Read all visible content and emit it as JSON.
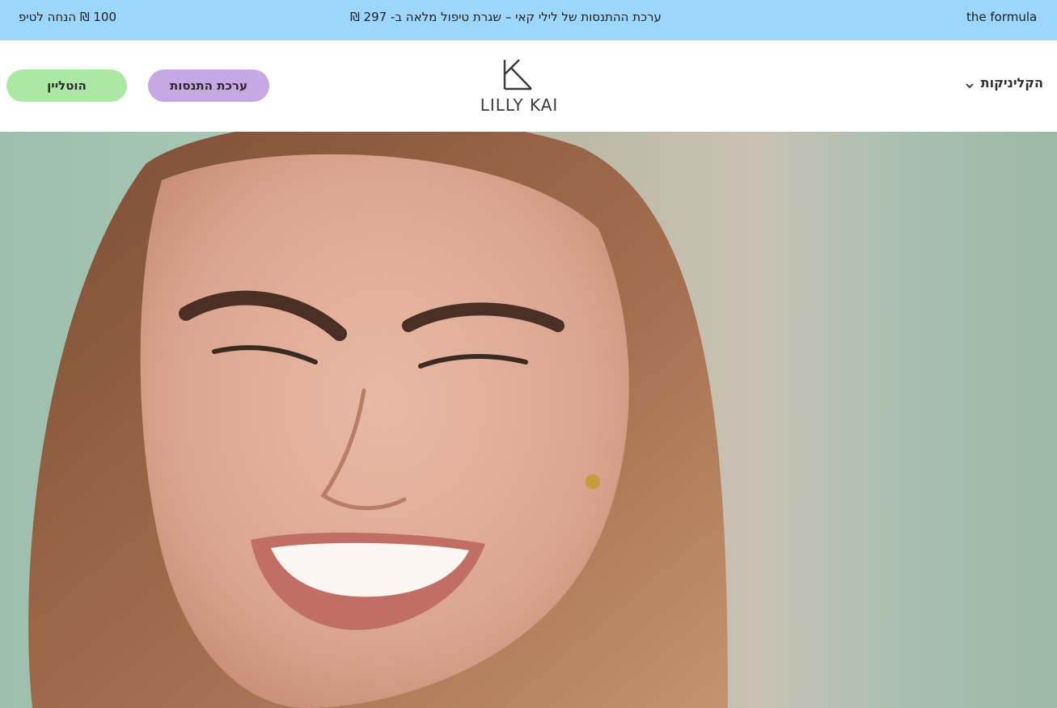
{
  "announcement": {
    "left_text": "100 ₪ הנחה לטיפ",
    "center_text": "ערכת ההתנסות של לילי קאי – שגרת טיפול מלאה ב- 297 ₪",
    "right_text": "the formula"
  },
  "header": {
    "hotline_label": "הוטליין",
    "kit_label": "ערכת התנסות",
    "logo_text": "LILLY KAI",
    "clinics_label": "הקליניקות"
  },
  "hero": {
    "image_alt": "smiling woman"
  },
  "colors": {
    "announcement_bg": "#9dd6fb",
    "hotline_bg": "#abe8a4",
    "kit_bg": "#c5a8e4"
  }
}
